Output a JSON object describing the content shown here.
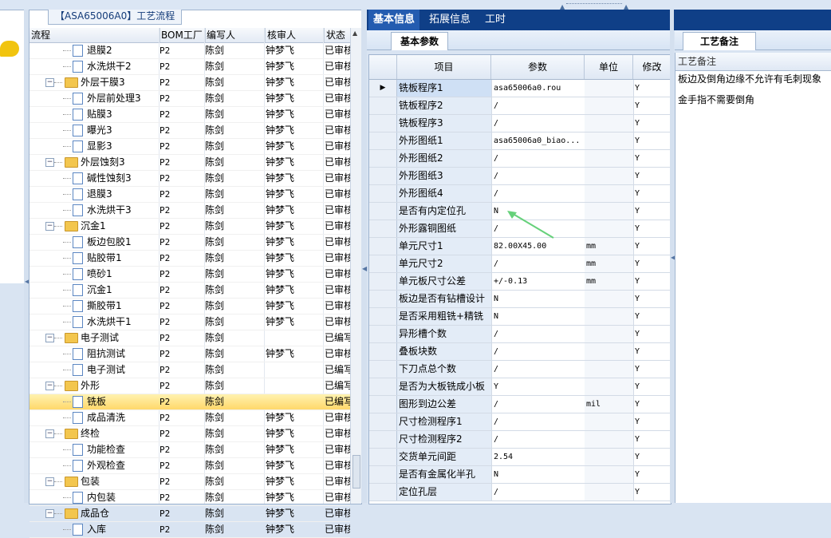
{
  "tree": {
    "title": "【ASA65006A0】工艺流程",
    "columns": [
      "流程",
      "BOM工厂",
      "编写人",
      "核审人",
      "状态"
    ],
    "rows": [
      {
        "level": 2,
        "type": "doc",
        "name": "退膜2",
        "bom": "P2",
        "writer": "陈剑",
        "reviewer": "钟梦飞",
        "status": "已审核"
      },
      {
        "level": 2,
        "type": "doc",
        "name": "水洗烘干2",
        "bom": "P2",
        "writer": "陈剑",
        "reviewer": "钟梦飞",
        "status": "已审核"
      },
      {
        "level": 1,
        "type": "folder",
        "name": "外层干膜3",
        "bom": "P2",
        "writer": "陈剑",
        "reviewer": "钟梦飞",
        "status": "已审核"
      },
      {
        "level": 2,
        "type": "doc",
        "name": "外层前处理3",
        "bom": "P2",
        "writer": "陈剑",
        "reviewer": "钟梦飞",
        "status": "已审核"
      },
      {
        "level": 2,
        "type": "doc",
        "name": "贴膜3",
        "bom": "P2",
        "writer": "陈剑",
        "reviewer": "钟梦飞",
        "status": "已审核"
      },
      {
        "level": 2,
        "type": "doc",
        "name": "曝光3",
        "bom": "P2",
        "writer": "陈剑",
        "reviewer": "钟梦飞",
        "status": "已审核"
      },
      {
        "level": 2,
        "type": "doc",
        "name": "显影3",
        "bom": "P2",
        "writer": "陈剑",
        "reviewer": "钟梦飞",
        "status": "已审核"
      },
      {
        "level": 1,
        "type": "folder",
        "name": "外层蚀刻3",
        "bom": "P2",
        "writer": "陈剑",
        "reviewer": "钟梦飞",
        "status": "已审核"
      },
      {
        "level": 2,
        "type": "doc",
        "name": "碱性蚀刻3",
        "bom": "P2",
        "writer": "陈剑",
        "reviewer": "钟梦飞",
        "status": "已审核"
      },
      {
        "level": 2,
        "type": "doc",
        "name": "退膜3",
        "bom": "P2",
        "writer": "陈剑",
        "reviewer": "钟梦飞",
        "status": "已审核"
      },
      {
        "level": 2,
        "type": "doc",
        "name": "水洗烘干3",
        "bom": "P2",
        "writer": "陈剑",
        "reviewer": "钟梦飞",
        "status": "已审核"
      },
      {
        "level": 1,
        "type": "folder",
        "name": "沉金1",
        "bom": "P2",
        "writer": "陈剑",
        "reviewer": "钟梦飞",
        "status": "已审核"
      },
      {
        "level": 2,
        "type": "doc",
        "name": "板边包胶1",
        "bom": "P2",
        "writer": "陈剑",
        "reviewer": "钟梦飞",
        "status": "已审核"
      },
      {
        "level": 2,
        "type": "doc",
        "name": "贴胶带1",
        "bom": "P2",
        "writer": "陈剑",
        "reviewer": "钟梦飞",
        "status": "已审核"
      },
      {
        "level": 2,
        "type": "doc",
        "name": "喷砂1",
        "bom": "P2",
        "writer": "陈剑",
        "reviewer": "钟梦飞",
        "status": "已审核"
      },
      {
        "level": 2,
        "type": "doc",
        "name": "沉金1",
        "bom": "P2",
        "writer": "陈剑",
        "reviewer": "钟梦飞",
        "status": "已审核"
      },
      {
        "level": 2,
        "type": "doc",
        "name": "撕胶带1",
        "bom": "P2",
        "writer": "陈剑",
        "reviewer": "钟梦飞",
        "status": "已审核"
      },
      {
        "level": 2,
        "type": "doc",
        "name": "水洗烘干1",
        "bom": "P2",
        "writer": "陈剑",
        "reviewer": "钟梦飞",
        "status": "已审核"
      },
      {
        "level": 1,
        "type": "folder",
        "name": "电子测试",
        "bom": "P2",
        "writer": "陈剑",
        "reviewer": "",
        "status": "已编写"
      },
      {
        "level": 2,
        "type": "doc",
        "name": "阻抗测试",
        "bom": "P2",
        "writer": "陈剑",
        "reviewer": "钟梦飞",
        "status": "已审核"
      },
      {
        "level": 2,
        "type": "doc",
        "name": "电子测试",
        "bom": "P2",
        "writer": "陈剑",
        "reviewer": "",
        "status": "已编写"
      },
      {
        "level": 1,
        "type": "folder",
        "name": "外形",
        "bom": "P2",
        "writer": "陈剑",
        "reviewer": "",
        "status": "已编写"
      },
      {
        "level": 2,
        "type": "doc",
        "name": "铣板",
        "bom": "P2",
        "writer": "陈剑",
        "reviewer": "",
        "status": "已编写",
        "selected": true
      },
      {
        "level": 2,
        "type": "doc",
        "name": "成品清洗",
        "bom": "P2",
        "writer": "陈剑",
        "reviewer": "钟梦飞",
        "status": "已审核"
      },
      {
        "level": 1,
        "type": "folder",
        "name": "终检",
        "bom": "P2",
        "writer": "陈剑",
        "reviewer": "钟梦飞",
        "status": "已审核"
      },
      {
        "level": 2,
        "type": "doc",
        "name": "功能检查",
        "bom": "P2",
        "writer": "陈剑",
        "reviewer": "钟梦飞",
        "status": "已审核"
      },
      {
        "level": 2,
        "type": "doc",
        "name": "外观检查",
        "bom": "P2",
        "writer": "陈剑",
        "reviewer": "钟梦飞",
        "status": "已审核"
      },
      {
        "level": 1,
        "type": "folder",
        "name": "包装",
        "bom": "P2",
        "writer": "陈剑",
        "reviewer": "钟梦飞",
        "status": "已审核"
      },
      {
        "level": 2,
        "type": "doc",
        "name": "内包装",
        "bom": "P2",
        "writer": "陈剑",
        "reviewer": "钟梦飞",
        "status": "已审核"
      },
      {
        "level": 1,
        "type": "folder",
        "name": "成品仓",
        "bom": "P2",
        "writer": "陈剑",
        "reviewer": "钟梦飞",
        "status": "已审核"
      },
      {
        "level": 2,
        "type": "doc",
        "name": "入库",
        "bom": "P2",
        "writer": "陈剑",
        "reviewer": "钟梦飞",
        "status": "已审核"
      }
    ]
  },
  "tabs": [
    "基本信息",
    "拓展信息",
    "工时"
  ],
  "subtab": "基本参数",
  "grid": {
    "columns": [
      "项目",
      "参数",
      "单位",
      "修改"
    ],
    "rows": [
      {
        "item": "铣板程序1",
        "param": "asa65006a0.rou",
        "unit": "",
        "mod": "Y",
        "current": true
      },
      {
        "item": "铣板程序2",
        "param": "/",
        "unit": "",
        "mod": "Y"
      },
      {
        "item": "铣板程序3",
        "param": "/",
        "unit": "",
        "mod": "Y"
      },
      {
        "item": "外形图纸1",
        "param": "asa65006a0_biao...",
        "unit": "",
        "mod": "Y"
      },
      {
        "item": "外形图纸2",
        "param": "/",
        "unit": "",
        "mod": "Y"
      },
      {
        "item": "外形图纸3",
        "param": "/",
        "unit": "",
        "mod": "Y"
      },
      {
        "item": "外形图纸4",
        "param": "/",
        "unit": "",
        "mod": "Y"
      },
      {
        "item": "是否有内定位孔",
        "param": "N",
        "unit": "",
        "mod": "Y"
      },
      {
        "item": "外形露铜图纸",
        "param": "/",
        "unit": "",
        "mod": "Y"
      },
      {
        "item": "单元尺寸1",
        "param": "82.00X45.00",
        "unit": "mm",
        "mod": "Y"
      },
      {
        "item": "单元尺寸2",
        "param": "/",
        "unit": "mm",
        "mod": "Y"
      },
      {
        "item": "单元板尺寸公差",
        "param": "+/-0.13",
        "unit": "mm",
        "mod": "Y"
      },
      {
        "item": "板边是否有钻槽设计",
        "param": "N",
        "unit": "",
        "mod": "Y"
      },
      {
        "item": "是否采用粗铣+精铣",
        "param": "N",
        "unit": "",
        "mod": "Y"
      },
      {
        "item": "异形槽个数",
        "param": "/",
        "unit": "",
        "mod": "Y"
      },
      {
        "item": "叠板块数",
        "param": "/",
        "unit": "",
        "mod": "Y"
      },
      {
        "item": "下刀点总个数",
        "param": "/",
        "unit": "",
        "mod": "Y"
      },
      {
        "item": "是否为大板铣成小板",
        "param": "Y",
        "unit": "",
        "mod": "Y"
      },
      {
        "item": "图形到边公差",
        "param": "/",
        "unit": "mil",
        "mod": "Y"
      },
      {
        "item": "尺寸检测程序1",
        "param": "/",
        "unit": "",
        "mod": "Y"
      },
      {
        "item": "尺寸检测程序2",
        "param": "/",
        "unit": "",
        "mod": "Y"
      },
      {
        "item": "交货单元间距",
        "param": "2.54",
        "unit": "",
        "mod": "Y"
      },
      {
        "item": "是否有金属化半孔",
        "param": "N",
        "unit": "",
        "mod": "Y"
      },
      {
        "item": "定位孔层",
        "param": "/",
        "unit": "",
        "mod": "Y"
      }
    ]
  },
  "notes": {
    "tab": "工艺备注",
    "header": "工艺备注",
    "lines": [
      "板边及倒角边缘不允许有毛刺现象",
      "金手指不需要倒角"
    ]
  },
  "annotation_color": "#66d17a"
}
